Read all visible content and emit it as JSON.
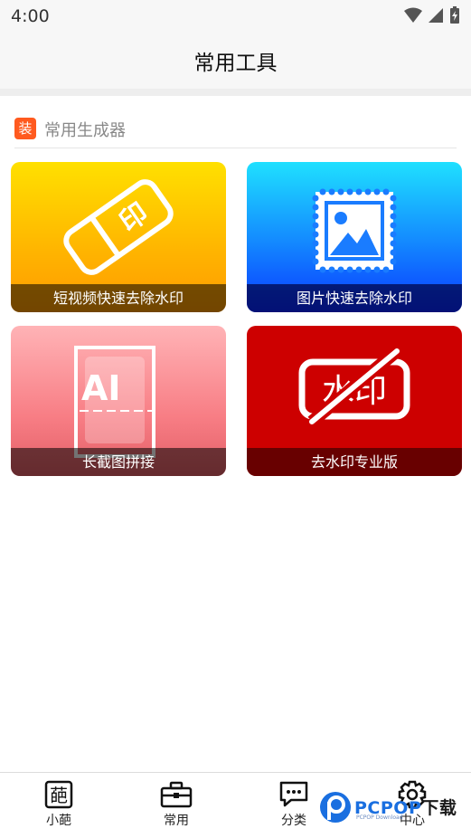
{
  "status_bar": {
    "time": "4:00"
  },
  "app_bar": {
    "title": "常用工具"
  },
  "section": {
    "badge": "装",
    "title": "常用生成器"
  },
  "tools": [
    {
      "label": "短视频快速去除水印",
      "icon": "eraser-icon",
      "icon_text": "印",
      "color": "#ffb400"
    },
    {
      "label": "图片快速去除水印",
      "icon": "image-stamp-icon",
      "color": "#1386ff"
    },
    {
      "label": "长截图拼接",
      "icon": "long-screenshot-icon",
      "icon_text": "AI",
      "color": "#f87e85"
    },
    {
      "label": "去水印专业版",
      "icon": "no-watermark-icon",
      "icon_text": "水印",
      "color": "#cd0000"
    }
  ],
  "bottom_nav": [
    {
      "label": "小葩",
      "icon": "xiaopa-icon",
      "icon_text": "葩"
    },
    {
      "label": "常用",
      "icon": "toolbox-icon"
    },
    {
      "label": "分类",
      "icon": "chat-bubbles-icon"
    },
    {
      "label": "中心",
      "icon": "gear-icon"
    }
  ],
  "watermark": {
    "brand": "PCPOP",
    "accent": "下载",
    "sub": "PCPOP Download"
  }
}
